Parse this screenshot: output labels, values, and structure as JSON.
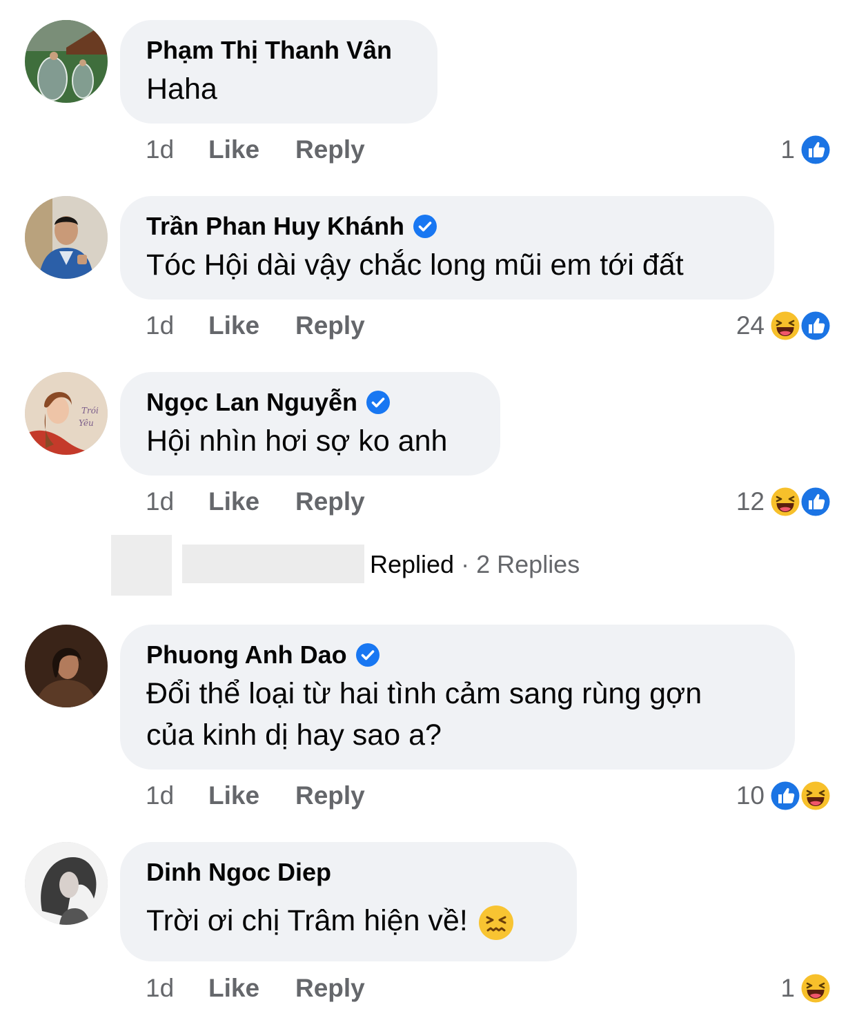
{
  "comments": [
    {
      "author": "Phạm Thị Thanh Vân",
      "verified": false,
      "text": "Haha",
      "time": "1d",
      "like": "Like",
      "reply": "Reply",
      "reaction_count": "1",
      "reactions": [
        "like-icon"
      ]
    },
    {
      "author": "Trần Phan Huy Khánh",
      "verified": true,
      "text": "Tóc Hội dài vậy chắc long mũi em tới đất",
      "time": "1d",
      "like": "Like",
      "reply": "Reply",
      "reaction_count": "24",
      "reactions": [
        "haha-icon",
        "like-icon"
      ]
    },
    {
      "author": "Ngọc Lan Nguyễn",
      "verified": true,
      "text": "Hội nhìn hơi sợ ko anh",
      "time": "1d",
      "like": "Like",
      "reply": "Reply",
      "reaction_count": "12",
      "reactions": [
        "haha-icon",
        "like-icon"
      ]
    },
    {
      "author": "Phuong Anh Dao",
      "verified": true,
      "text_line1": "Đổi thể loại từ hai tình cảm sang rùng gợn",
      "text_line2": "của kinh dị hay sao a?",
      "time": "1d",
      "like": "Like",
      "reply": "Reply",
      "reaction_count": "10",
      "reactions": [
        "like-icon",
        "haha-icon"
      ]
    },
    {
      "author": "Dinh Ngoc Diep",
      "verified": false,
      "text": "Trời ơi chị Trâm hiện về!",
      "time": "1d",
      "like": "Like",
      "reply": "Reply",
      "reaction_count": "1",
      "reactions": [
        "haha-icon"
      ]
    }
  ],
  "replied_row": {
    "label": "Replied",
    "separator": "·",
    "replies": "2 Replies"
  },
  "colors": {
    "bubble": "#f0f2f5",
    "meta_text": "#65676b",
    "facebook_blue": "#1877f2",
    "haha_yellow": "#f7b125"
  }
}
